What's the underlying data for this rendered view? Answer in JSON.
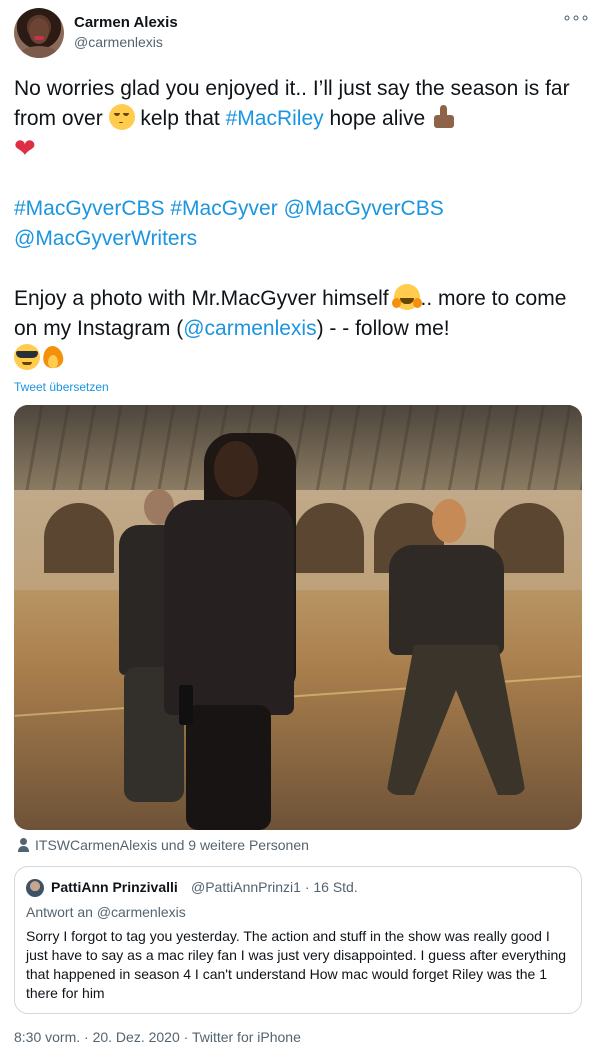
{
  "author": {
    "name": "Carmen Alexis",
    "handle": "@carmenlexis",
    "more_icon": "more-horizontal-icon"
  },
  "tweet": {
    "line1_a": "No worries glad you enjoyed it.. I’ll just say the season is far from over ",
    "line1_b": " kelp that ",
    "hashtag_macriley": "#MacRiley",
    "line1_c": " hope alive ",
    "heart": "❤",
    "hashtags": "#MacGyverCBS #MacGyver @MacGyverCBS @MacGyverWriters",
    "line3_a": "Enjoy a photo with Mr.MacGyver himself ",
    "line3_b": ".. more to come on my Instagram (",
    "mention_insta": "@carmenlexis",
    "line3_c": ") - - follow me!",
    "emojis": [
      "smirking-face",
      "thumbs-up",
      "red-heart",
      "hugging-face",
      "sunglasses-face",
      "fire"
    ]
  },
  "translate_label": "Tweet übersetzen",
  "photo": {
    "description_icon": "photo-image"
  },
  "tagged": {
    "text": "ITSWCarmenAlexis und 9 weitere Personen"
  },
  "quote": {
    "name": "PattiAnn Prinzivalli",
    "meta": "@PattiAnnPrinzi1 · 16 Std.",
    "reply_to": "Antwort an @carmenlexis",
    "text": "Sorry I forgot to tag you yesterday. The action and stuff in the show was really good I just have to say as a mac riley fan I was just very disappointed. I guess after everything that happened in season 4 I can't understand How mac would forget Riley was the 1 there for him"
  },
  "footer": {
    "timestamp": "8:30 vorm. · 20. Dez. 2020 · Twitter for iPhone"
  },
  "colors": {
    "link": "#1b95e0",
    "muted": "#536471",
    "text": "#0f1419"
  }
}
